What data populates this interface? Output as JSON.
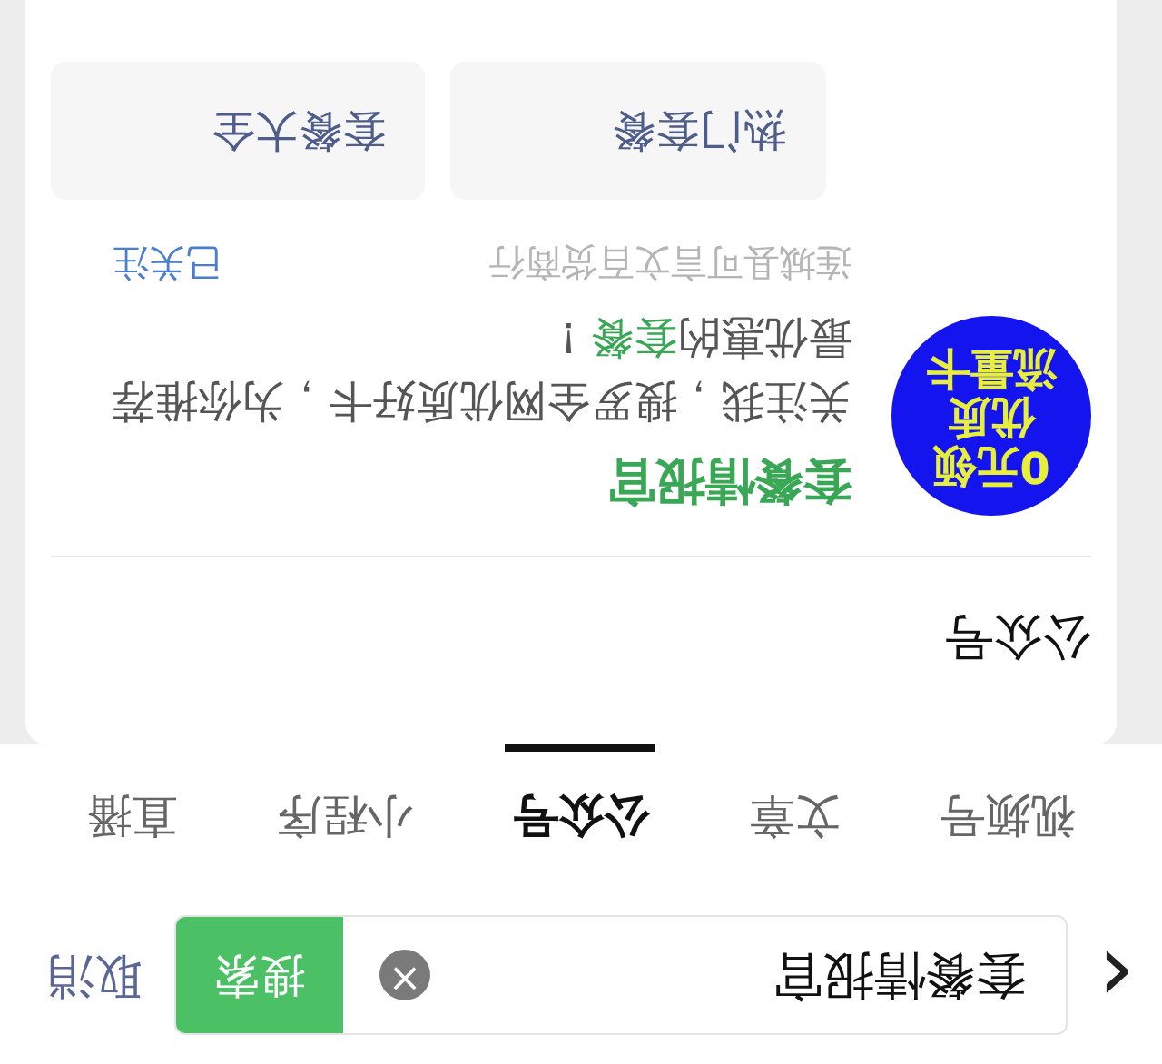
{
  "view": {
    "rotated": true
  },
  "search_bar": {
    "back": "‹",
    "query": "套餐情报官",
    "clear": "×",
    "search_button": "搜索",
    "cancel": "取消"
  },
  "tabs": [
    {
      "label": "视频号",
      "selected": false
    },
    {
      "label": "文章",
      "selected": false
    },
    {
      "label": "公众号",
      "selected": true
    },
    {
      "label": "小程序",
      "selected": false
    },
    {
      "label": "直播",
      "selected": false
    }
  ],
  "section": {
    "title": "公众号",
    "account": {
      "avatar_lines": [
        "0元领",
        "优质",
        "流量卡"
      ],
      "name": "套餐情报官",
      "description": [
        {
          "text": "关注我，搜罗全网优质好卡，为你推荐最优惠的",
          "highlight": false
        },
        {
          "text": "套餐",
          "highlight": true
        },
        {
          "text": "！",
          "highlight": false
        }
      ],
      "owner": "连城县可言文百货商行",
      "follow_status": "已关注"
    },
    "buttons": [
      "热门套餐",
      "套餐大全"
    ]
  }
}
